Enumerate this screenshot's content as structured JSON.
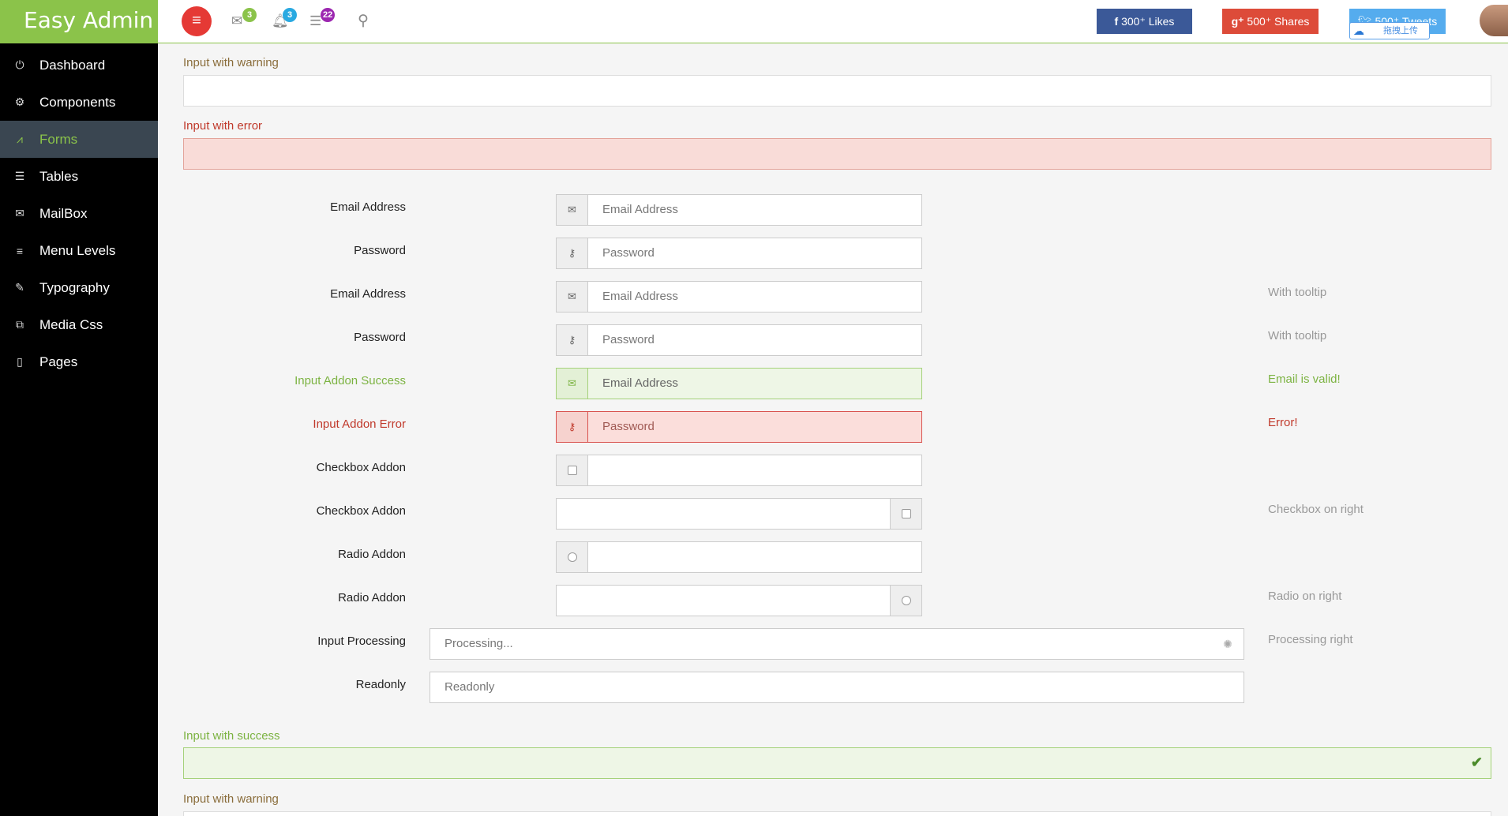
{
  "brand": "Easy Admin",
  "sidebar": {
    "items": [
      {
        "label": "Dashboard",
        "icon": "power-icon",
        "glyph": "⏻"
      },
      {
        "label": "Components",
        "icon": "gear-icon",
        "glyph": "⚙"
      },
      {
        "label": "Forms",
        "icon": "chart-icon",
        "glyph": "⩘"
      },
      {
        "label": "Tables",
        "icon": "list-icon",
        "glyph": "☰"
      },
      {
        "label": "MailBox",
        "icon": "envelope-icon",
        "glyph": "✉"
      },
      {
        "label": "Menu Levels",
        "icon": "menu-levels-icon",
        "glyph": "≡"
      },
      {
        "label": "Typography",
        "icon": "pencil-icon",
        "glyph": "✎"
      },
      {
        "label": "Media Css",
        "icon": "media-icon",
        "glyph": "⧉"
      },
      {
        "label": "Pages",
        "icon": "book-icon",
        "glyph": "▯"
      }
    ],
    "active": "Forms"
  },
  "topbar": {
    "menu_glyph": "≡",
    "mail_count": "3",
    "bell_count": "3",
    "list_count": "22",
    "facebook_label": "300⁺ Likes",
    "gplus_label": "500⁺ Shares",
    "twitter_label": "500⁺ Tweets",
    "upload_label": "拖拽上传",
    "colors": {
      "facebook": "#3b5998",
      "gplus": "#dd4b39",
      "twitter": "#55acee",
      "green": "#8bc34a"
    }
  },
  "form": {
    "warning_label_top": "Input with warning",
    "error_label": "Input with error",
    "rows": [
      {
        "label": "Email Address",
        "placeholder": "Email Address",
        "help": ""
      },
      {
        "label": "Password",
        "placeholder": "Password",
        "help": ""
      },
      {
        "label": "Email Address",
        "placeholder": "Email Address",
        "help": "With tooltip"
      },
      {
        "label": "Password",
        "placeholder": "Password",
        "help": "With tooltip"
      },
      {
        "label": "Input Addon Success",
        "placeholder": "Email Address",
        "help": "Email is valid!"
      },
      {
        "label": "Input Addon Error",
        "placeholder": "Password",
        "help": "Error!"
      },
      {
        "label": "Checkbox Addon",
        "placeholder": "",
        "help": ""
      },
      {
        "label": "Checkbox Addon",
        "placeholder": "",
        "help": "Checkbox on right"
      },
      {
        "label": "Radio Addon",
        "placeholder": "",
        "help": ""
      },
      {
        "label": "Radio Addon",
        "placeholder": "",
        "help": "Radio on right"
      }
    ],
    "processing_label": "Input Processing",
    "processing_value": "Processing...",
    "processing_help": "Processing right",
    "readonly_label": "Readonly",
    "readonly_value": "Readonly",
    "success_label": "Input with success",
    "warning_label_bottom": "Input with warning"
  }
}
